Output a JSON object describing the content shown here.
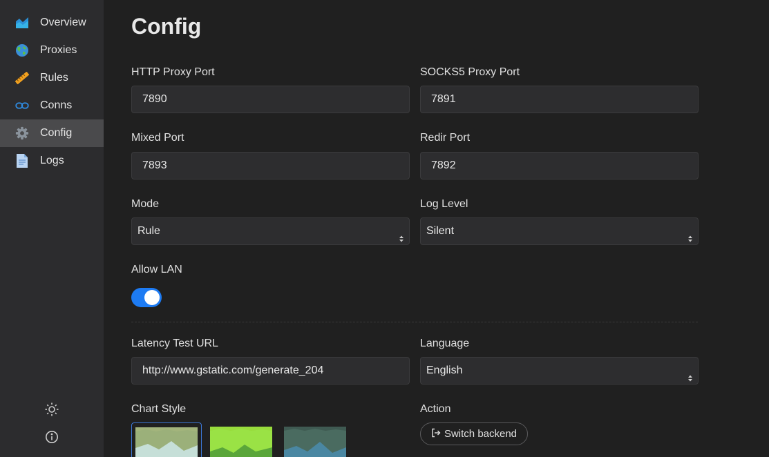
{
  "sidebar": {
    "items": [
      {
        "label": "Overview",
        "icon": "overview-chart-icon"
      },
      {
        "label": "Proxies",
        "icon": "globe-icon"
      },
      {
        "label": "Rules",
        "icon": "ruler-icon"
      },
      {
        "label": "Conns",
        "icon": "link-icon"
      },
      {
        "label": "Config",
        "icon": "gear-icon",
        "active": true
      },
      {
        "label": "Logs",
        "icon": "document-icon"
      }
    ],
    "bottom_icons": [
      "sun-icon",
      "info-icon"
    ]
  },
  "page": {
    "title": "Config"
  },
  "form": {
    "http_port": {
      "label": "HTTP Proxy Port",
      "value": "7890"
    },
    "socks_port": {
      "label": "SOCKS5 Proxy Port",
      "value": "7891"
    },
    "mixed_port": {
      "label": "Mixed Port",
      "value": "7893"
    },
    "redir_port": {
      "label": "Redir Port",
      "value": "7892"
    },
    "mode": {
      "label": "Mode",
      "value": "Rule"
    },
    "log_level": {
      "label": "Log Level",
      "value": "Silent"
    },
    "allow_lan": {
      "label": "Allow LAN",
      "on": true
    },
    "latency_url": {
      "label": "Latency Test URL",
      "value": "http://www.gstatic.com/generate_204"
    },
    "language": {
      "label": "Language",
      "value": "English"
    },
    "chart_style": {
      "label": "Chart Style",
      "selected_index": 0
    },
    "action": {
      "label": "Action",
      "button": "Switch backend"
    }
  },
  "colors": {
    "accent": "#1d7bf3",
    "sidebar_bg": "#2c2c2e",
    "main_bg": "#202020",
    "active_item_bg": "#4a4a4c"
  }
}
